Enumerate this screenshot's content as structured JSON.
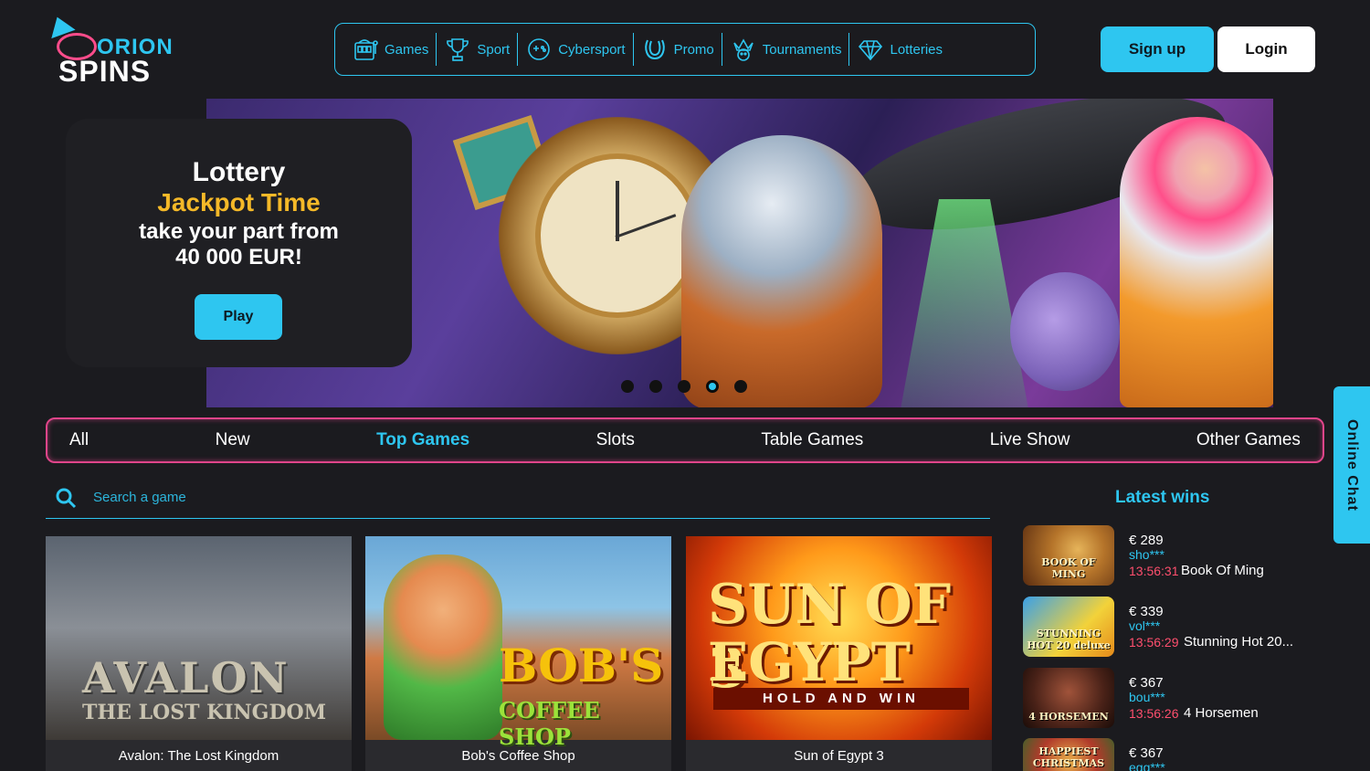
{
  "brand": {
    "logo_line1": "ORION",
    "logo_line2": "SPINS",
    "accent": "#2ec6f0",
    "pink": "#e0458a"
  },
  "nav": [
    {
      "label": "Games",
      "icon": "slot-machine-icon"
    },
    {
      "label": "Sport",
      "icon": "trophy-icon"
    },
    {
      "label": "Cybersport",
      "icon": "gamepad-icon"
    },
    {
      "label": "Promo",
      "icon": "horseshoe-icon"
    },
    {
      "label": "Tournaments",
      "icon": "jester-icon"
    },
    {
      "label": "Lotteries",
      "icon": "diamond-icon"
    }
  ],
  "auth": {
    "signup": "Sign up",
    "login": "Login"
  },
  "banner": {
    "line1": "Lottery",
    "line2": "Jackpot Time",
    "line3": "take your part from",
    "line4": "40 000 EUR!",
    "play": "Play",
    "slides": 5,
    "active_slide": 4
  },
  "categories": [
    "All",
    "New",
    "Top Games",
    "Slots",
    "Table Games",
    "Live Show",
    "Other Games"
  ],
  "active_category": "Top Games",
  "search": {
    "placeholder": "Search a game"
  },
  "games": [
    {
      "name": "Avalon: The Lost Kingdom",
      "art_title": "AVALON",
      "art_subtitle": "THE LOST KINGDOM"
    },
    {
      "name": "Bob's Coffee Shop",
      "art_title": "BOB'S",
      "art_subtitle": "COFFEE SHOP"
    },
    {
      "name": "Sun of Egypt 3",
      "art_title": "SUN OF 3",
      "art_subtitle": "EGYPT",
      "art_band": "HOLD AND WIN"
    }
  ],
  "latest_wins": {
    "title": "Latest wins",
    "items": [
      {
        "amount": "€ 289",
        "user": "sho***",
        "time": "13:56:31",
        "game": "Book Of Ming",
        "thumb_text": "BOOK OF MING"
      },
      {
        "amount": "€ 339",
        "user": "vol***",
        "time": "13:56:29",
        "game": "Stunning Hot 20...",
        "thumb_text": "STUNNING HOT 20 deluxe"
      },
      {
        "amount": "€ 367",
        "user": "bou***",
        "time": "13:56:26",
        "game": "4 Horsemen",
        "thumb_text": "4 HORSEMEN"
      },
      {
        "amount": "€ 367",
        "user": "egg***",
        "time": "",
        "game": "",
        "thumb_text": "HAPPIEST CHRISTMAS"
      }
    ]
  },
  "chat": {
    "label": "Online Chat"
  }
}
